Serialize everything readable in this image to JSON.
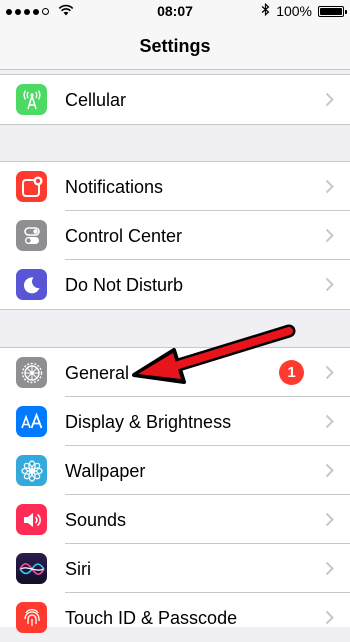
{
  "status_bar": {
    "time": "08:07",
    "battery_percent": "100%",
    "battery_level": 1.0,
    "signal_bars_filled": 4,
    "signal_bars_total": 5
  },
  "nav": {
    "title": "Settings"
  },
  "groups": [
    {
      "items": [
        {
          "label": "Cellular",
          "icon": "cellular-icon",
          "color": "#4cd964"
        }
      ]
    },
    {
      "items": [
        {
          "label": "Notifications",
          "icon": "notifications-icon",
          "color": "#ff3b30"
        },
        {
          "label": "Control Center",
          "icon": "control-center-icon",
          "color": "#8e8e93"
        },
        {
          "label": "Do Not Disturb",
          "icon": "moon-icon",
          "color": "#5856d6"
        }
      ]
    },
    {
      "items": [
        {
          "label": "General",
          "icon": "gear-icon",
          "color": "#8e8e93",
          "badge": "1"
        },
        {
          "label": "Display & Brightness",
          "icon": "display-icon",
          "color": "#007aff"
        },
        {
          "label": "Wallpaper",
          "icon": "wallpaper-icon",
          "color": "#34aadc"
        },
        {
          "label": "Sounds",
          "icon": "speaker-icon",
          "color": "#ff2d55"
        },
        {
          "label": "Siri",
          "icon": "siri-icon",
          "color": "#1c1c3a"
        },
        {
          "label": "Touch ID & Passcode",
          "icon": "fingerprint-icon",
          "color": "#ff3b30"
        }
      ]
    }
  ],
  "annotation": {
    "color": "#e8141c",
    "points_to": "General"
  }
}
